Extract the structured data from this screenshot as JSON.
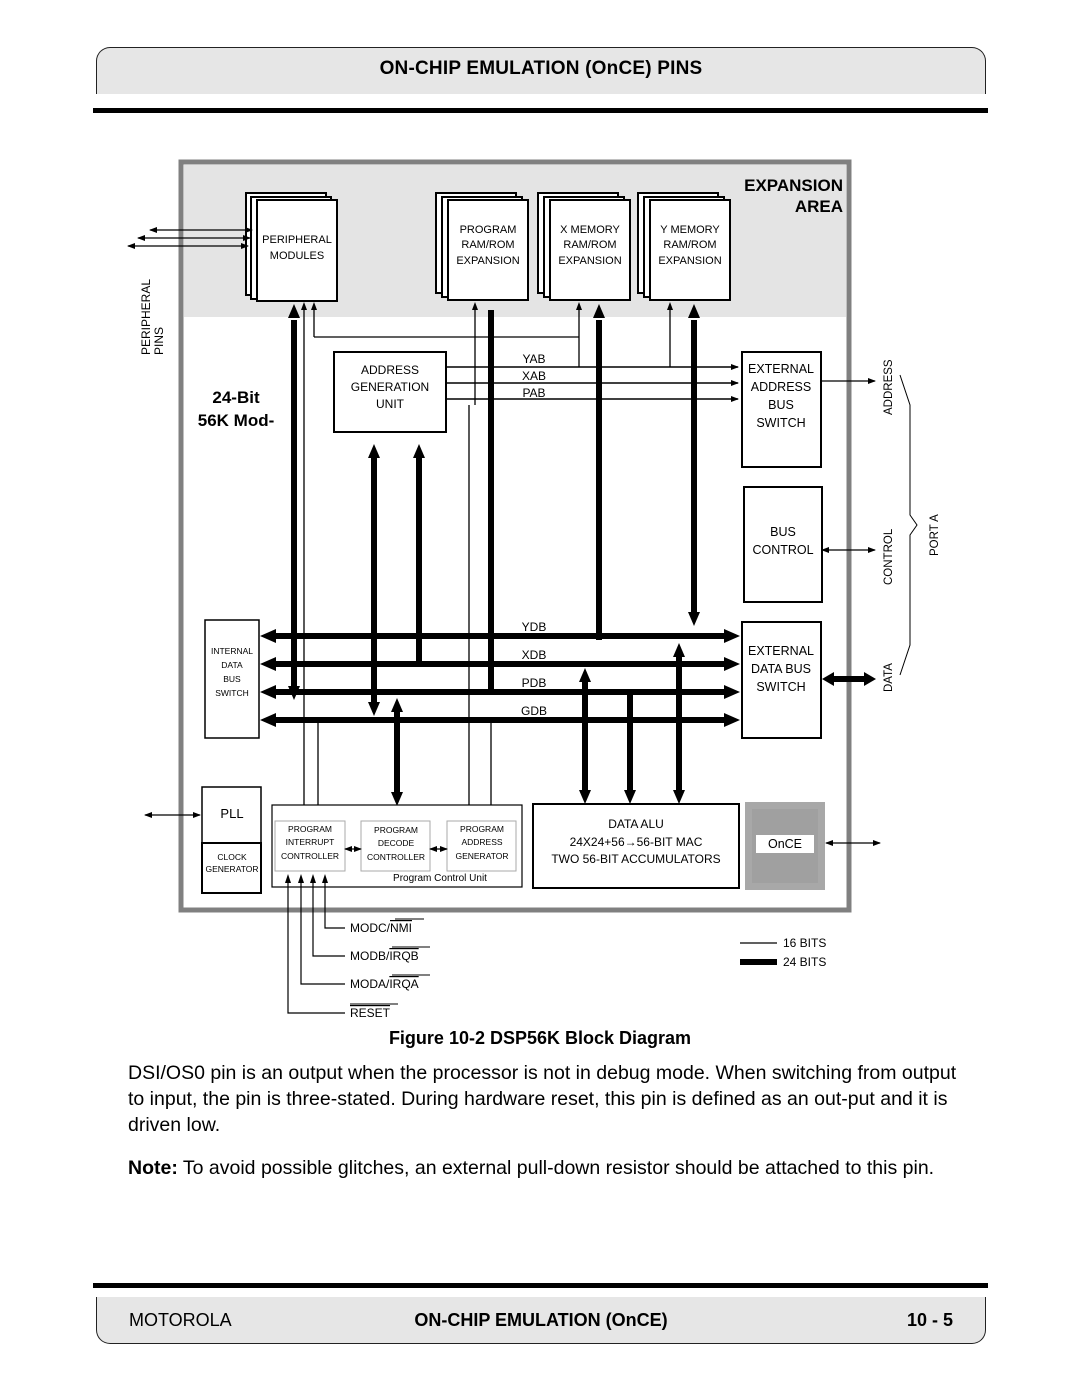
{
  "header": {
    "title": "ON-CHIP EMULATION (OnCE) PINS"
  },
  "diagram": {
    "expansion_area": [
      "EXPANSION",
      "AREA"
    ],
    "core_label": [
      "24-Bit",
      "56K Mod-"
    ],
    "peripheral_pins": [
      "PERIPHERAL",
      "PINS"
    ],
    "peripheral_modules": [
      "PERIPHERAL",
      "MODULES"
    ],
    "program_expansion": [
      "PROGRAM",
      "RAM/ROM",
      "EXPANSION"
    ],
    "x_memory": [
      "X MEMORY",
      "RAM/ROM",
      "EXPANSION"
    ],
    "y_memory": [
      "Y MEMORY",
      "RAM/ROM",
      "EXPANSION"
    ],
    "agu": [
      "ADDRESS",
      "GENERATION",
      "UNIT"
    ],
    "address_buses": [
      "YAB",
      "XAB",
      "PAB"
    ],
    "ext_address_switch": [
      "EXTERNAL",
      "ADDRESS",
      "BUS",
      "SWITCH"
    ],
    "bus_control": [
      "BUS",
      "CONTROL"
    ],
    "ext_data_switch": [
      "EXTERNAL",
      "DATA BUS",
      "SWITCH"
    ],
    "port_labels": {
      "address": "ADDRESS",
      "control": "CONTROL",
      "data": "DATA",
      "port": "PORT A"
    },
    "data_buses": [
      "YDB",
      "XDB",
      "PDB",
      "GDB"
    ],
    "internal_switch": [
      "INTERNAL",
      "DATA",
      "BUS",
      "SWITCH"
    ],
    "pll": "PLL",
    "clock_generator": [
      "CLOCK",
      "GENERATOR"
    ],
    "pic": [
      "PROGRAM",
      "INTERRUPT",
      "CONTROLLER"
    ],
    "pdc": [
      "PROGRAM",
      "DECODE",
      "CONTROLLER"
    ],
    "pag": [
      "PROGRAM",
      "ADDRESS",
      "GENERATOR"
    ],
    "pcu_label": "Program Control Unit",
    "data_alu": [
      "DATA ALU",
      "24X24+56→56-BIT MAC",
      "TWO 56-BIT ACCUMULATORS"
    ],
    "once": "OnCE",
    "mode_pins": [
      {
        "name": "MODC/",
        "bar": "NMI"
      },
      {
        "name": "MODB/",
        "bar": "IRQB"
      },
      {
        "name": "MODA/",
        "bar": "IRQA"
      },
      {
        "name": "",
        "bar": "RESET"
      }
    ],
    "legend": {
      "thin": "16 BITS",
      "thick": "24 BITS"
    }
  },
  "caption": "Figure  10-2 DSP56K Block Diagram",
  "body": {
    "paragraph": "DSI/OS0 pin is an output when the processor is not in debug mode. When switching from output to input, the pin is three-stated. During hardware reset, this pin is defined as an out-put and it is driven low.",
    "note_label": "Note:",
    "note_text": " To avoid possible glitches, an external pull-down resistor should be attached to this pin."
  },
  "footer": {
    "left": "MOTOROLA",
    "center": "ON-CHIP EMULATION (OnCE)",
    "right": "10 - 5"
  },
  "colors": {
    "header_bg": "#e6e6e6",
    "frame_gray": "#808080",
    "expansion_bg": "#e4e4e4",
    "once_gray": "#a8a8a8"
  }
}
